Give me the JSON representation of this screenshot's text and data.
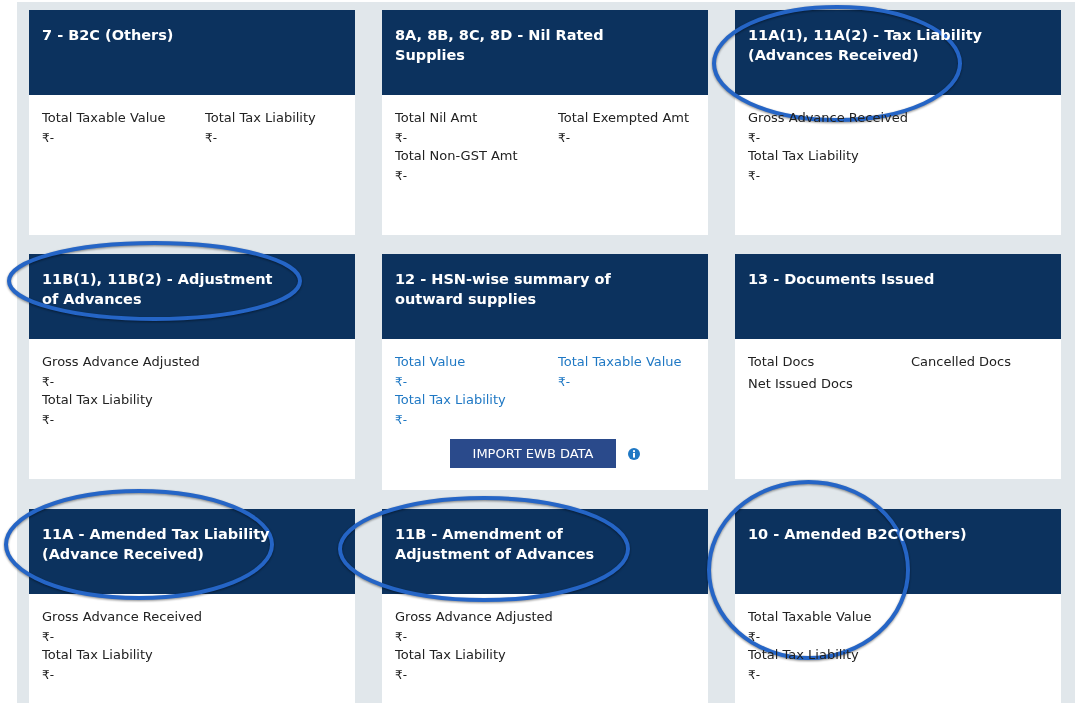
{
  "cards": [
    {
      "title": "7 - B2C (Others)",
      "highlighted": false,
      "rows": [
        [
          {
            "kind": "plain",
            "label": "Total Taxable Value",
            "value": "₹-"
          },
          {
            "kind": "plain",
            "label": "Total Tax Liability",
            "value": "₹-"
          }
        ]
      ]
    },
    {
      "title": "8A, 8B, 8C, 8D - Nil Rated Supplies",
      "highlighted": false,
      "rows": [
        [
          {
            "kind": "plain",
            "label": "Total Nil Amt",
            "value": "₹-"
          },
          {
            "kind": "plain",
            "label": "Total Exempted Amt",
            "value": "₹-"
          }
        ],
        [
          {
            "kind": "plain",
            "label": "Total Non-GST Amt",
            "value": "₹-"
          }
        ]
      ]
    },
    {
      "title": "11A(1), 11A(2) - Tax Liability (Advances Received)",
      "highlighted": true,
      "rows": [
        [
          {
            "kind": "plain",
            "label": "Gross Advance Received",
            "value": "₹-"
          }
        ],
        [
          {
            "kind": "plain",
            "label": "Total Tax Liability",
            "value": "₹-"
          }
        ]
      ]
    },
    {
      "title": "11B(1), 11B(2) - Adjustment of Advances",
      "highlighted": true,
      "rows": [
        [
          {
            "kind": "plain",
            "label": "Gross Advance Adjusted",
            "value": "₹-"
          }
        ],
        [
          {
            "kind": "plain",
            "label": "Total Tax Liability",
            "value": "₹-"
          }
        ]
      ]
    },
    {
      "title": "12 - HSN-wise summary of outward supplies",
      "highlighted": false,
      "rows": [
        [
          {
            "kind": "link",
            "label": "Total Value",
            "value": "₹-"
          },
          {
            "kind": "link",
            "label": "Total Taxable Value",
            "value": "₹-"
          }
        ],
        [
          {
            "kind": "link",
            "label": "Total Tax Liability",
            "value": "₹-"
          }
        ]
      ],
      "button": "IMPORT EWB DATA"
    },
    {
      "title": "13 - Documents Issued",
      "highlighted": false,
      "rows": [
        [
          {
            "kind": "plain",
            "label": "Total Docs"
          },
          {
            "kind": "plain",
            "label": "Cancelled Docs"
          }
        ],
        [
          {
            "kind": "plain",
            "label": "Net Issued Docs"
          }
        ]
      ]
    },
    {
      "title": "11A - Amended Tax Liability (Advance Received)",
      "highlighted": true,
      "rows": [
        [
          {
            "kind": "plain",
            "label": "Gross Advance Received",
            "value": "₹-"
          }
        ],
        [
          {
            "kind": "plain",
            "label": "Total Tax Liability",
            "value": "₹-"
          }
        ]
      ]
    },
    {
      "title": "11B - Amendment of Adjustment of Advances",
      "highlighted": true,
      "rows": [
        [
          {
            "kind": "plain",
            "label": "Gross Advance Adjusted",
            "value": "₹-"
          }
        ],
        [
          {
            "kind": "plain",
            "label": "Total Tax Liability",
            "value": "₹-"
          }
        ]
      ]
    },
    {
      "title": "10 - Amended B2C(Others)",
      "highlighted": true,
      "rows": [
        [
          {
            "kind": "plain",
            "label": "Total Taxable Value",
            "value": "₹-"
          }
        ],
        [
          {
            "kind": "plain",
            "label": "Total Tax Liability",
            "value": "₹-"
          }
        ]
      ]
    }
  ]
}
